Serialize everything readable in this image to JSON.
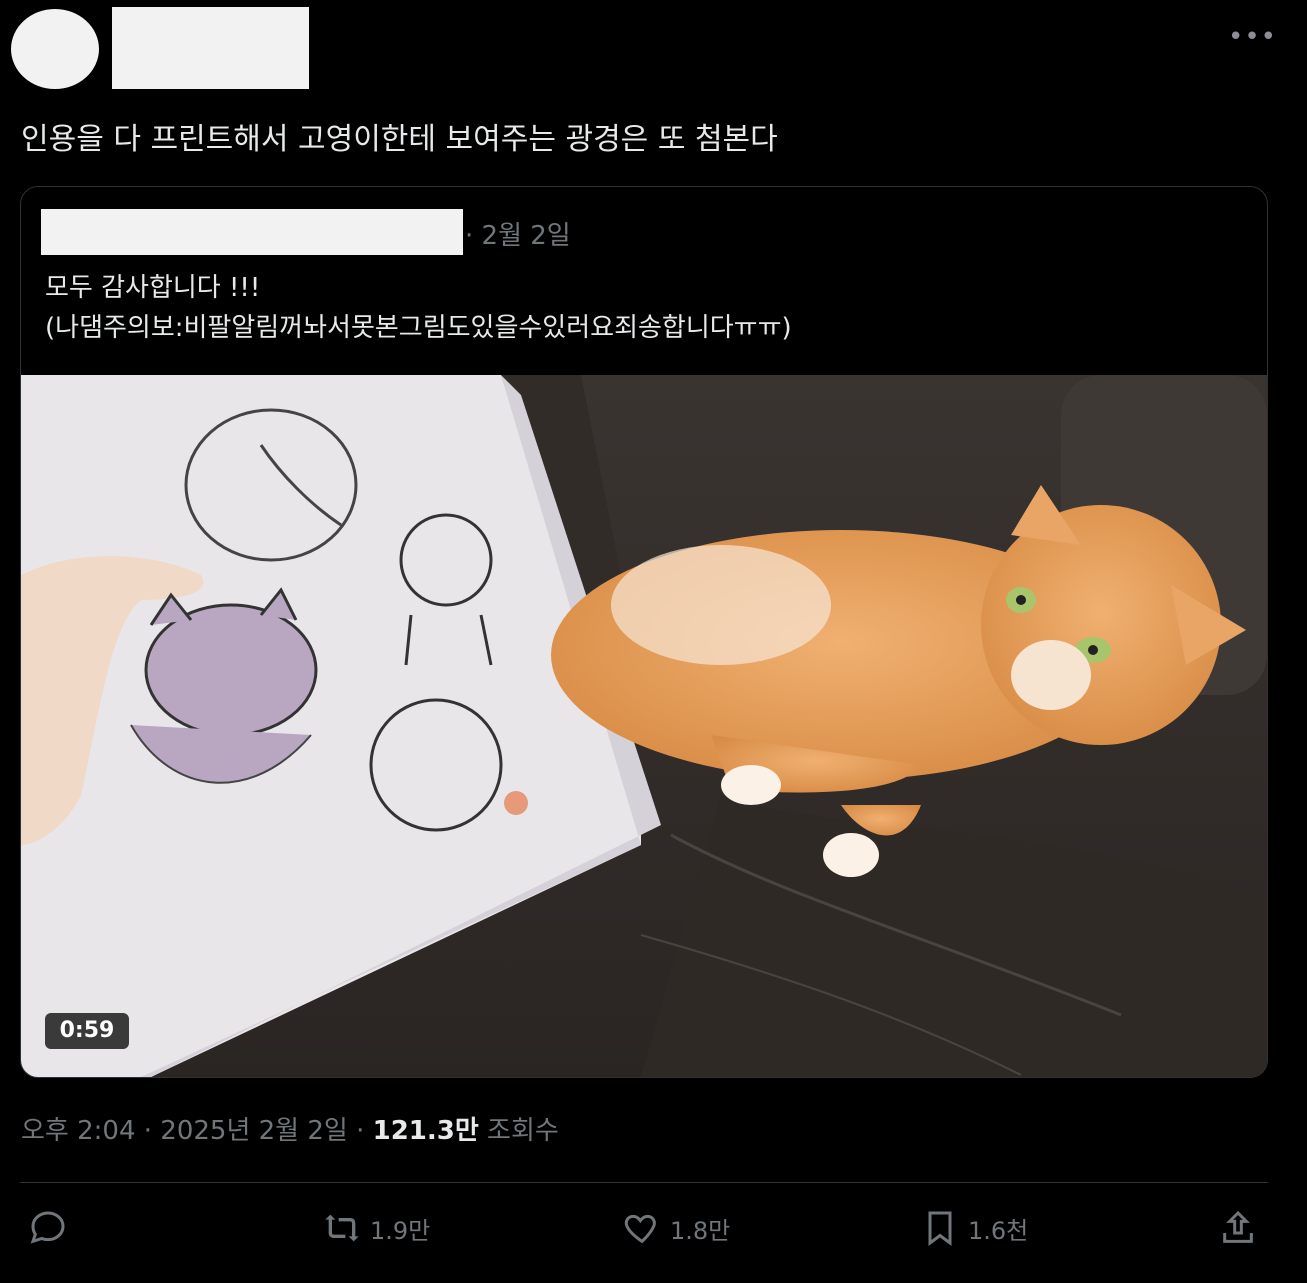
{
  "tweet": {
    "text": "인용을 다 프린트해서 고영이한테 보여주는 광경은 또 첨본다",
    "more_icon": "more-horizontal-icon"
  },
  "quote": {
    "date": "· 2월 2일",
    "line1": "모두 감사합니다 !!!",
    "line2": "(나댐주의보:비팔알림꺼놔서못본그림도있을수있러요죄송합니다ㅠㅠ)",
    "video_duration": "0:59"
  },
  "meta": {
    "time_date": "오후 2:04 · 2025년 2월 2일 · ",
    "views_count": "121.3만",
    "views_label": " 조회수"
  },
  "actions": {
    "reply": {
      "icon": "reply-icon",
      "count": ""
    },
    "retweet": {
      "icon": "retweet-icon",
      "count": "1.9만"
    },
    "like": {
      "icon": "heart-icon",
      "count": "1.8만"
    },
    "bookmark": {
      "icon": "bookmark-icon",
      "count": "1.6천"
    },
    "share": {
      "icon": "share-icon",
      "count": ""
    }
  },
  "colors": {
    "background": "#000000",
    "text": "#e7e9ea",
    "muted": "#71767b",
    "border": "#2f3336"
  }
}
